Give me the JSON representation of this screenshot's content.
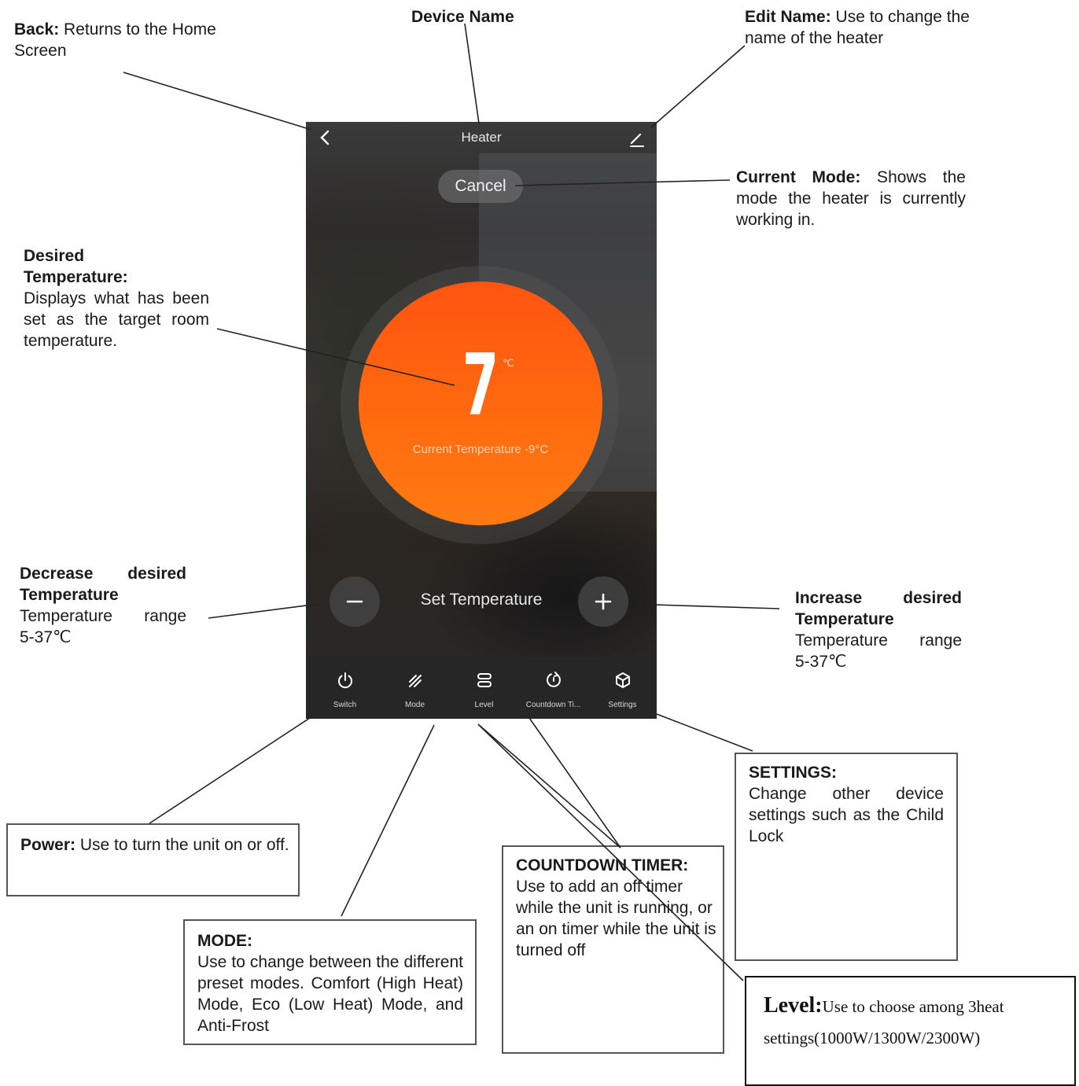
{
  "app": {
    "title": "Heater",
    "cancel_label": "Cancel",
    "target_temperature": "7",
    "temperature_unit": "℃",
    "current_temperature": "Current Temperature -9°C",
    "set_temperature_label": "Set Temperature",
    "tabs": [
      {
        "label": "Switch",
        "icon": "power-icon"
      },
      {
        "label": "Mode",
        "icon": "mode-slashes-icon"
      },
      {
        "label": "Level",
        "icon": "level-icon"
      },
      {
        "label": "Countdown Ti...",
        "icon": "countdown-icon"
      },
      {
        "label": "Settings",
        "icon": "settings-cube-icon"
      }
    ]
  },
  "annotations": {
    "back": {
      "title": "Back:",
      "text": " Returns to the Home Screen"
    },
    "device_name": {
      "title": "Device Name"
    },
    "edit_name": {
      "title": "Edit Name:",
      "text": " Use to change the name of the heater"
    },
    "current_mode": {
      "title": "Current Mode:",
      "text": " Shows the mode the heater is currently working in."
    },
    "desired_temperature": {
      "title": "Desired Temperature:",
      "text": "Displays what has been set as the target room temperature."
    },
    "decrease": {
      "title": "Decrease desired Temperature",
      "text": "Temperature range",
      "range": "5-37℃"
    },
    "increase": {
      "title": "Increase desired Temperature",
      "text": "Temperature range",
      "range": "5-37℃"
    },
    "power": {
      "title": "Power:",
      "text": " Use to turn the unit on or off."
    },
    "mode": {
      "title": "MODE:",
      "text": "Use to change between the different preset modes. Comfort (High Heat) Mode, Eco (Low Heat) Mode, and Anti-Frost"
    },
    "countdown": {
      "title": "COUNTDOWN TIMER:",
      "text": "Use to add an off timer while the unit is running, or an on timer while the unit is turned off"
    },
    "settings": {
      "title": "SETTINGS:",
      "text": "Change other device settings such as the Child Lock"
    },
    "level": {
      "title": "Level:",
      "text": "Use to choose among 3heat settings(1000W/1300W/2300W)"
    }
  },
  "colors": {
    "dial_top": "#ff5410",
    "dial_bottom": "#ff7a12",
    "tabbar": "#262626"
  }
}
